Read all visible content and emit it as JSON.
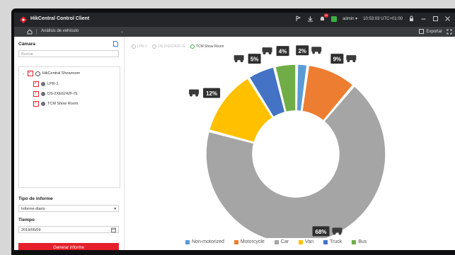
{
  "window": {
    "title": "HikCentral Control Client",
    "user": "admin",
    "clock": "10:53:03 UTC+01:00",
    "alarm_count": "10",
    "brand_color": "#e5202b"
  },
  "nav": {
    "module": "Análisis de vehículo",
    "export_label": "Exportar"
  },
  "sidebar": {
    "camera_label": "Cámara",
    "search_placeholder": "Buscar",
    "tree": {
      "root": "HikCentral Showroom",
      "items": [
        "LPR-1",
        "DS-2XE6242F-IS",
        "TCM Show Room"
      ]
    },
    "report_type_label": "Tipo de informe",
    "report_type_value": "Informe diario",
    "time_label": "Tiempo",
    "time_value": "2019/05/09",
    "generate_button": "Generar informe"
  },
  "camera_legend": [
    "LPR-1",
    "DS-2XE6242F-IS",
    "TCM Show Room"
  ],
  "chart_data": {
    "type": "pie",
    "categories": [
      "Non-motorized",
      "Motorcycle",
      "Car",
      "Van",
      "Truck",
      "Bus"
    ],
    "values": [
      2,
      9,
      68,
      12,
      5,
      4
    ],
    "labels": [
      "2%",
      "9%",
      "68%",
      "12%",
      "5%",
      "4%"
    ],
    "colors": [
      "#5b9bd5",
      "#ed7d31",
      "#a5a5a5",
      "#ffc000",
      "#4472c4",
      "#70ad47"
    ],
    "icons": [
      "bicycle-icon",
      "motorcycle-icon",
      "car-icon",
      "van-icon",
      "truck-icon",
      "bus-icon"
    ],
    "legend_position": "bottom"
  }
}
